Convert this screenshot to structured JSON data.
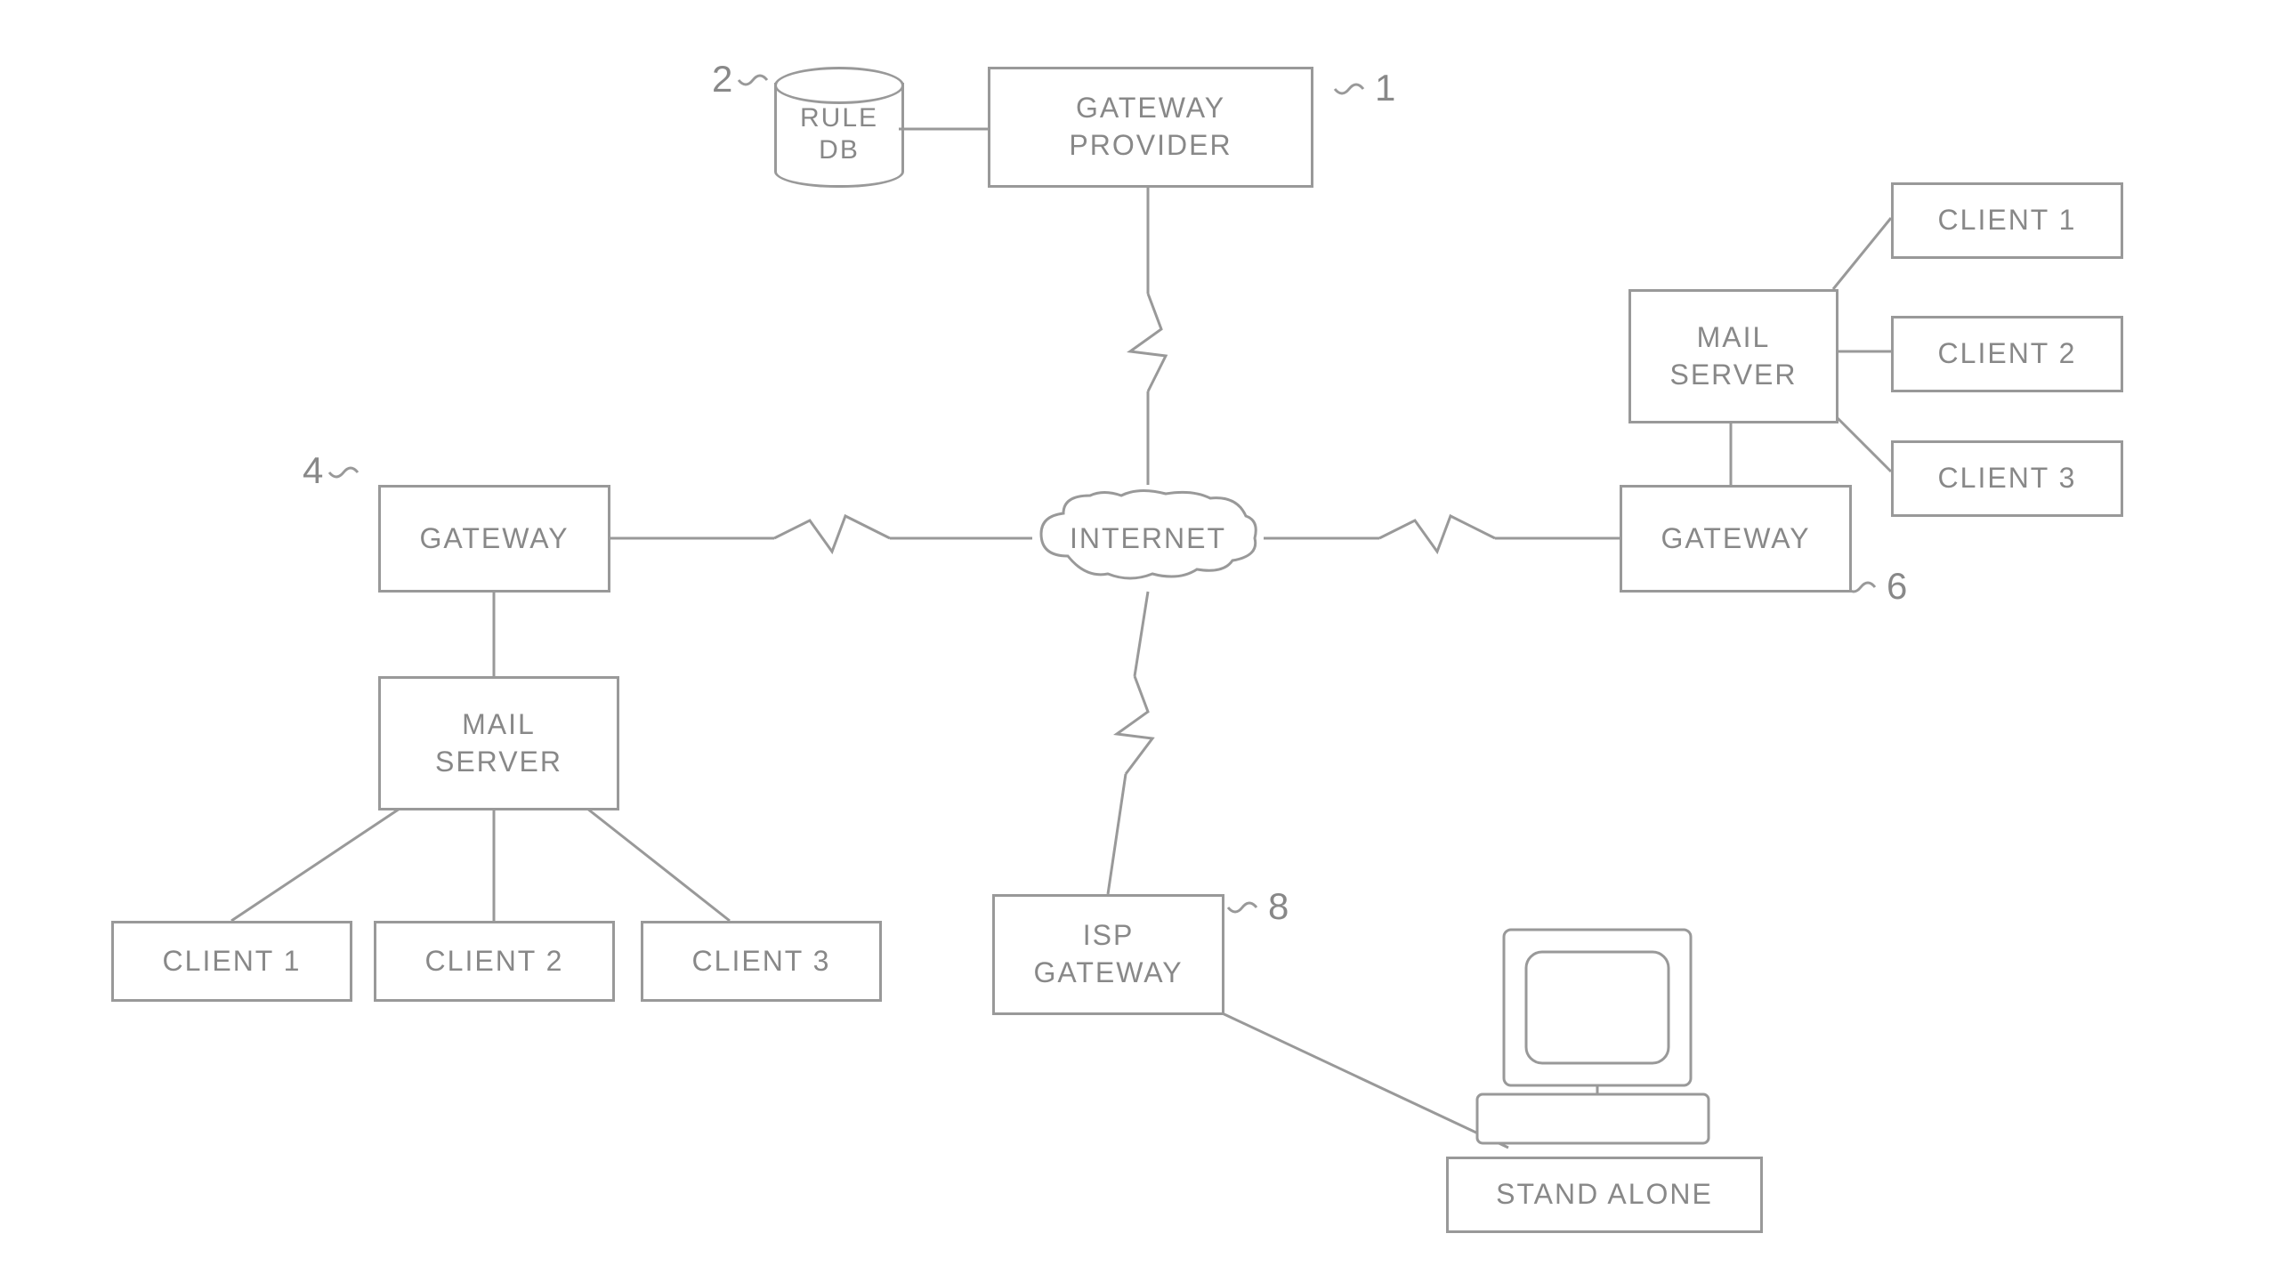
{
  "nodes": {
    "rule_db": "RULE\nDB",
    "gateway_provider": "GATEWAY\nPROVIDER",
    "internet": "INTERNET",
    "gateway_left": "GATEWAY",
    "mail_server_left": "MAIL\nSERVER",
    "client1_left": "CLIENT 1",
    "client2_left": "CLIENT 2",
    "client3_left": "CLIENT 3",
    "gateway_right": "GATEWAY",
    "mail_server_right": "MAIL\nSERVER",
    "client1_right": "CLIENT 1",
    "client2_right": "CLIENT 2",
    "client3_right": "CLIENT 3",
    "isp_gateway": "ISP\nGATEWAY",
    "stand_alone": "STAND ALONE"
  },
  "labels": {
    "1": "1",
    "2": "2",
    "4": "4",
    "6": "6",
    "8": "8"
  }
}
